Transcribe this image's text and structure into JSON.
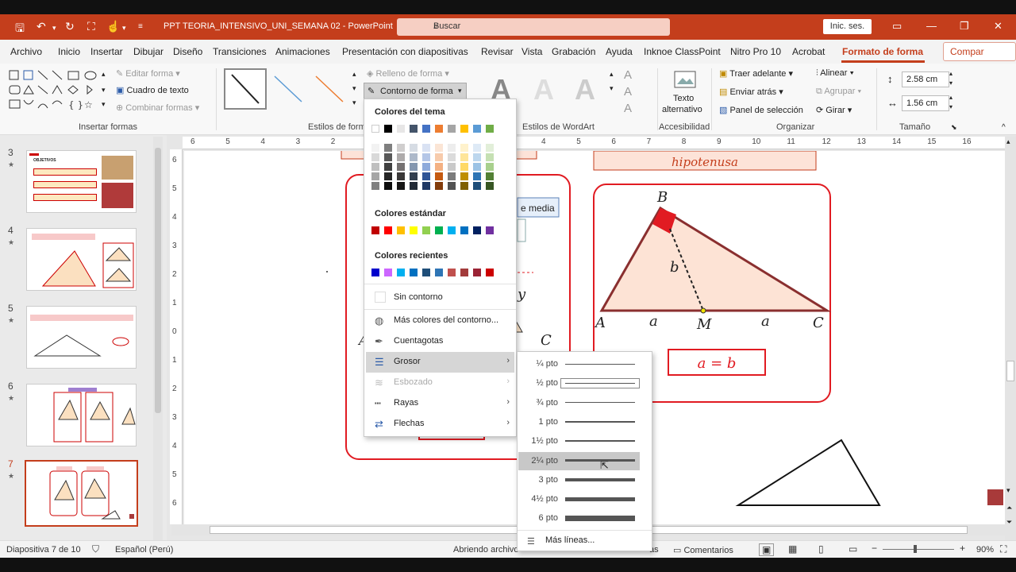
{
  "titlebar": {
    "doc_title": "PPT TEORIA_INTENSIVO_UNI_SEMANA 02  -  PowerPoint",
    "search_placeholder": "Buscar",
    "signin": "Inic. ses."
  },
  "menu": {
    "tabs": [
      "Archivo",
      "Inicio",
      "Insertar",
      "Dibujar",
      "Diseño",
      "Transiciones",
      "Animaciones",
      "Presentación con diapositivas",
      "Revisar",
      "Vista",
      "Grabación",
      "Ayuda",
      "Inknoe ClassPoint",
      "Nitro Pro 10",
      "Acrobat",
      "Formato de forma"
    ],
    "share": "Compar"
  },
  "ribbon": {
    "insertar_formas": "Insertar formas",
    "editar_forma": "Editar forma",
    "cuadro_texto": "Cuadro de texto",
    "combinar_formas": "Combinar formas",
    "estilos_forma": "Estilos de form",
    "relleno_forma": "Relleno de forma",
    "contorno_forma": "Contorno de forma",
    "estilos_wordart": "Estilos de WordArt",
    "texto_alternativo_1": "Texto",
    "texto_alternativo_2": "alternativo",
    "accesibilidad": "Accesibilidad",
    "traer_adelante": "Traer adelante",
    "enviar_atras": "Enviar atrás",
    "panel_seleccion": "Panel de selección",
    "alinear": "Alinear",
    "agrupar": "Agrupar",
    "girar": "Girar",
    "organizar": "Organizar",
    "alto": "2.58 cm",
    "ancho": "1.56 cm",
    "tamano": "Tamaño"
  },
  "slides": {
    "numbers": [
      "3",
      "4",
      "5",
      "6",
      "7"
    ],
    "thumb3_title": "OBJETIVOS"
  },
  "ruler": {
    "h_ticks": [
      "6",
      "5",
      "4",
      "3",
      "2",
      "1",
      "0",
      "1",
      "2",
      "3",
      "4",
      "5",
      "6",
      "7",
      "8",
      "9",
      "10",
      "11",
      "12",
      "13",
      "14",
      "15",
      "16"
    ],
    "v_ticks": [
      "6",
      "5",
      "4",
      "3",
      "2",
      "1",
      "0",
      "1",
      "2",
      "3",
      "4",
      "5",
      "6"
    ]
  },
  "slide": {
    "hipotenusa": "hipotenusa",
    "media_label": "e media",
    "B": "B",
    "b": "b",
    "A": "A",
    "a1": "a",
    "M": "M",
    "a2": "a",
    "C": "C",
    "eq": "a = b",
    "y_label": "y",
    "c_label": "C",
    "a_left": "A"
  },
  "outline_menu": {
    "colores_tema": "Colores del tema",
    "colores_estandar": "Colores estándar",
    "colores_recientes": "Colores recientes",
    "theme_row": [
      "#ffffff",
      "#000000",
      "#e7e6e6",
      "#44546a",
      "#4472c4",
      "#ed7d31",
      "#a5a5a5",
      "#ffc000",
      "#5b9bd5",
      "#70ad47"
    ],
    "shade_cols": [
      [
        "#f2f2f2",
        "#d9d9d9",
        "#bfbfbf",
        "#a6a6a6",
        "#808080"
      ],
      [
        "#7f7f7f",
        "#595959",
        "#404040",
        "#262626",
        "#0d0d0d"
      ],
      [
        "#d0cece",
        "#aeabab",
        "#757171",
        "#3a3838",
        "#171616"
      ],
      [
        "#d6dce4",
        "#adb9ca",
        "#8497b0",
        "#333f4f",
        "#222a35"
      ],
      [
        "#d9e2f3",
        "#b4c6e7",
        "#8eaadb",
        "#2f5496",
        "#1f3864"
      ],
      [
        "#fbe5d5",
        "#f7cbac",
        "#f4b183",
        "#c55a11",
        "#833c0b"
      ],
      [
        "#ededed",
        "#dbdbdb",
        "#c9c9c9",
        "#7b7b7b",
        "#525252"
      ],
      [
        "#fff2cc",
        "#fee599",
        "#ffd965",
        "#bf8f00",
        "#7f6000"
      ],
      [
        "#deeaf6",
        "#bdd7ee",
        "#9cc3e5",
        "#2e75b5",
        "#1e4e79"
      ],
      [
        "#e2efd9",
        "#c5e0b3",
        "#a8d08d",
        "#538135",
        "#375623"
      ]
    ],
    "standard_row": [
      "#c00000",
      "#ff0000",
      "#ffc000",
      "#ffff00",
      "#92d050",
      "#00b050",
      "#00b0f0",
      "#0070c0",
      "#002060",
      "#7030a0"
    ],
    "recent_row": [
      "#0000cc",
      "#cc66ff",
      "#00b0f0",
      "#0070c0",
      "#1f4e79",
      "#2e75b5",
      "#c0504d",
      "#a23b3b",
      "#9b2335",
      "#cc0000"
    ],
    "sin_contorno": "Sin contorno",
    "mas_colores": "Más colores del contorno...",
    "cuentagotas": "Cuentagotas",
    "grosor": "Grosor",
    "esbozado": "Esbozado",
    "rayas": "Rayas",
    "flechas": "Flechas"
  },
  "weight_menu": {
    "items": [
      "¼ pto",
      "½ pto",
      "¾ pto",
      "1 pto",
      "1½ pto",
      "2¼ pto",
      "3 pto",
      "4½ pto",
      "6 pto"
    ],
    "mas_lineas": "Más líneas..."
  },
  "status": {
    "slide_of": "Diapositiva 7 de 10",
    "language": "Español (Perú)",
    "progress": "Abriendo archivo",
    "notas": "as",
    "comentarios": "Comentarios",
    "zoom": "90%"
  },
  "colors": {
    "accent": "#c43e1c",
    "slide_red": "#e11b22"
  }
}
